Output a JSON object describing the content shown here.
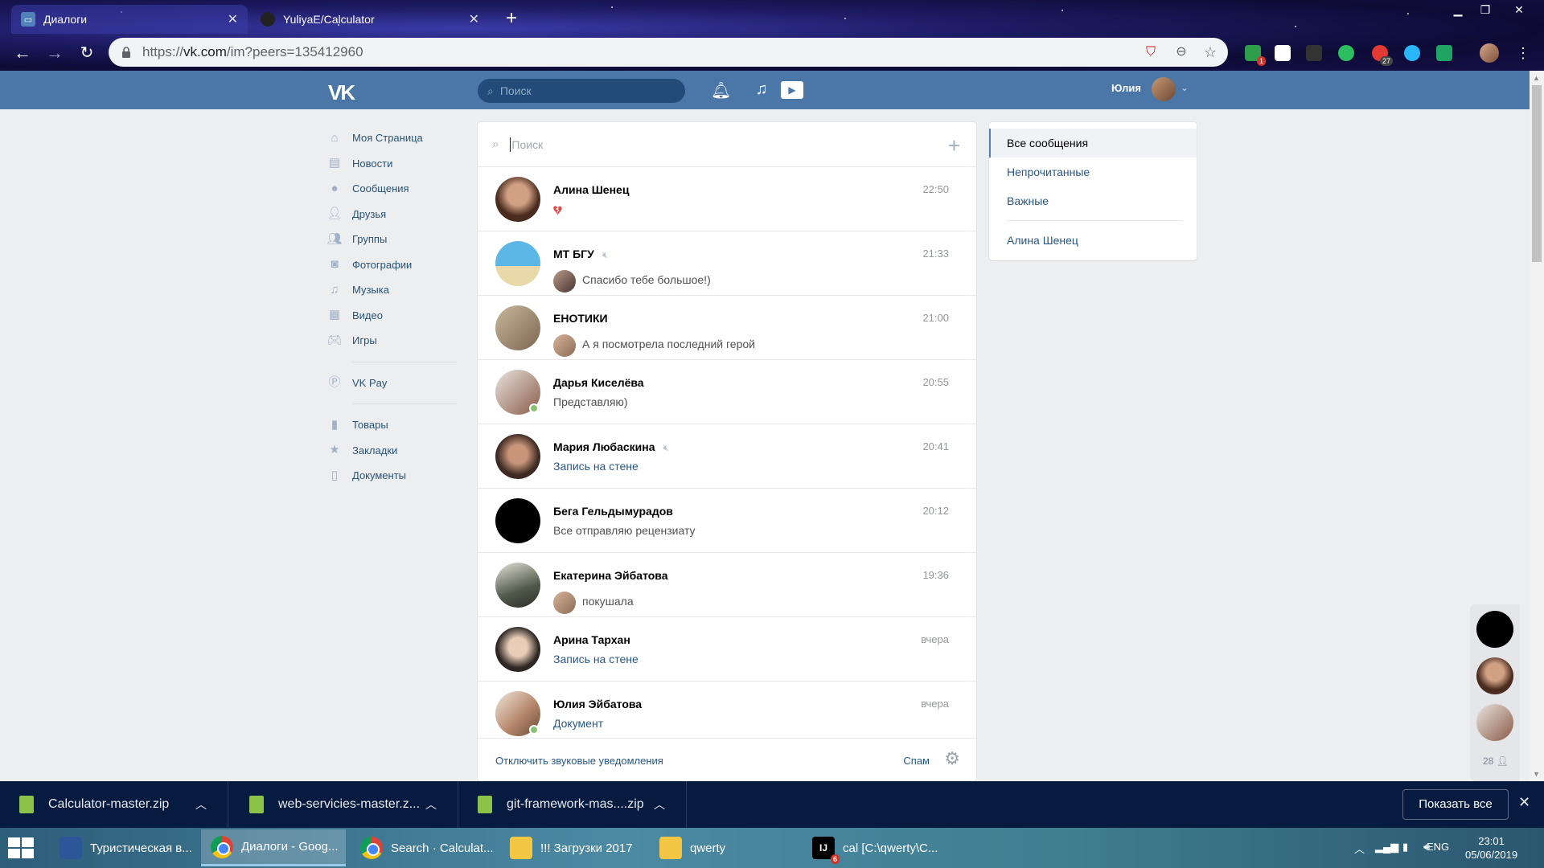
{
  "browser": {
    "tabs": [
      {
        "title": "Диалоги",
        "active": true
      },
      {
        "title": "YuliyaE/Calculator",
        "active": false
      }
    ],
    "url_scheme": "https://",
    "url_host": "vk.com",
    "url_path": "/im?peers=135412960",
    "extension_badges": {
      "first": "1",
      "second": "27"
    }
  },
  "vk": {
    "header": {
      "logo": "VK",
      "search_placeholder": "Поиск",
      "user_name": "Юлия"
    },
    "left_menu": {
      "main": [
        {
          "label": "Моя Страница",
          "icon": "home-icon"
        },
        {
          "label": "Новости",
          "icon": "news-icon"
        },
        {
          "label": "Сообщения",
          "icon": "messages-icon"
        },
        {
          "label": "Друзья",
          "icon": "friends-icon"
        },
        {
          "label": "Группы",
          "icon": "groups-icon"
        },
        {
          "label": "Фотографии",
          "icon": "camera-icon"
        },
        {
          "label": "Музыка",
          "icon": "music-icon"
        },
        {
          "label": "Видео",
          "icon": "video-icon"
        },
        {
          "label": "Игры",
          "icon": "games-icon"
        }
      ],
      "pay": [
        {
          "label": "VK Pay",
          "icon": "vkpay-icon"
        }
      ],
      "extra": [
        {
          "label": "Товары",
          "icon": "shopping-bag-icon"
        },
        {
          "label": "Закладки",
          "icon": "star-icon"
        },
        {
          "label": "Документы",
          "icon": "document-icon"
        }
      ]
    },
    "dialogs": {
      "search_placeholder": "Поиск",
      "items": [
        {
          "name": "Алина Шенец",
          "time": "22:50",
          "message": "",
          "muted": false,
          "link": false
        },
        {
          "name": "МТ БГУ",
          "time": "21:33",
          "message": "Спасибо тебе большое!)",
          "muted": true,
          "link": false
        },
        {
          "name": "ЕНОТИКИ",
          "time": "21:00",
          "message": "А я посмотрела последний герой",
          "muted": false,
          "link": false
        },
        {
          "name": "Дарья Киселёва",
          "time": "20:55",
          "message": "Представляю)",
          "muted": false,
          "link": false
        },
        {
          "name": "Мария Любаскина",
          "time": "20:41",
          "message": "Запись на стене",
          "muted": true,
          "link": true
        },
        {
          "name": "Бега Гельдымурадов",
          "time": "20:12",
          "message": "Все отправляю рецензиату",
          "muted": false,
          "link": false
        },
        {
          "name": "Екатерина Эйбатова",
          "time": "19:36",
          "message": "покушала",
          "muted": false,
          "link": false
        },
        {
          "name": "Арина Тархан",
          "time": "вчера",
          "message": "Запись на стене",
          "muted": false,
          "link": true
        },
        {
          "name": "Юлия Эйбатова",
          "time": "вчера",
          "message": "Документ",
          "muted": false,
          "link": true
        }
      ],
      "footer": {
        "mute_notifications": "Отключить звуковые уведомления",
        "spam": "Спам"
      }
    },
    "filters": {
      "items": [
        "Все сообщения",
        "Непрочитанные",
        "Важные"
      ],
      "pinned": "Алина Шенец"
    },
    "mini_chat": {
      "count": "28"
    }
  },
  "downloads": {
    "items": [
      "Calculator-master.zip",
      "web-servicies-master.z...",
      "git-framework-mas....zip"
    ],
    "show_all": "Показать все"
  },
  "taskbar": {
    "items": [
      {
        "label": "Туристическая в...",
        "icon": "word-icon"
      },
      {
        "label": "Диалоги - Goog...",
        "icon": "chrome-icon"
      },
      {
        "label": "Search · Calculat...",
        "icon": "chrome-icon"
      },
      {
        "label": "!!! Загрузки 2017",
        "icon": "folder-icon"
      },
      {
        "label": "qwerty",
        "icon": "folder-icon"
      },
      {
        "label": "cal [C:\\qwerty\\C...",
        "icon": "intellij-icon"
      }
    ],
    "tray_lang": "ENG",
    "time": "23:01",
    "date": "05/06/2019",
    "intellij_badge": "6"
  }
}
